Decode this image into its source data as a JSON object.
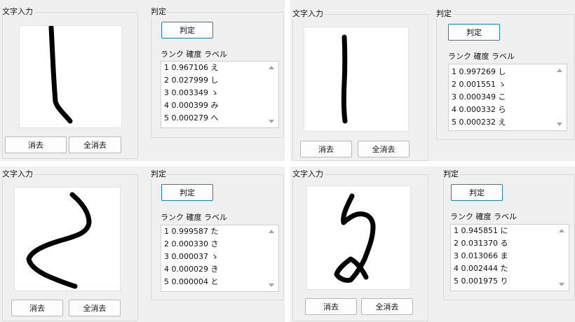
{
  "panels": [
    {
      "input_group_title": "文字入力",
      "judge_group_title": "判定",
      "judge_button": "判定",
      "erase_button": "消去",
      "erase_all_button": "全消去",
      "list_header": "ランク 確度 ラベル",
      "results": [
        "1 0.967106 え",
        "2 0.027999 し",
        "3 0.003349 ゝ",
        "4 0.000399 み",
        "5 0.000279 へ"
      ]
    },
    {
      "input_group_title": "文字入力",
      "judge_group_title": "判定",
      "judge_button": "判定",
      "erase_button": "消去",
      "erase_all_button": "全消去",
      "list_header": "ランク 確度 ラベル",
      "results": [
        "1 0.997269 し",
        "2 0.001551 ゝ",
        "3 0.000349 こ",
        "4 0.000332 ら",
        "5 0.000232 え"
      ]
    },
    {
      "input_group_title": "文字入力",
      "judge_group_title": "判定",
      "judge_button": "判定",
      "erase_button": "消去",
      "erase_all_button": "全消去",
      "list_header": "ランク 確度 ラベル",
      "results": [
        "1 0.999587 た",
        "2 0.000330 さ",
        "3 0.000037 ゝ",
        "4 0.000029 き",
        "5 0.000004 と"
      ]
    },
    {
      "input_group_title": "文字入力",
      "judge_group_title": "判定",
      "judge_button": "判定",
      "erase_button": "消去",
      "erase_all_button": "全消去",
      "list_header": "ランク 確度 ラベル",
      "results": [
        "1 0.945851 に",
        "2 0.031370 る",
        "3 0.013066 ま",
        "4 0.002444 た",
        "5 0.001975 り"
      ]
    }
  ],
  "colors": {
    "window_bg": "#f0f0f0",
    "focus_border": "#1e7bd6",
    "stroke": "#000000"
  }
}
